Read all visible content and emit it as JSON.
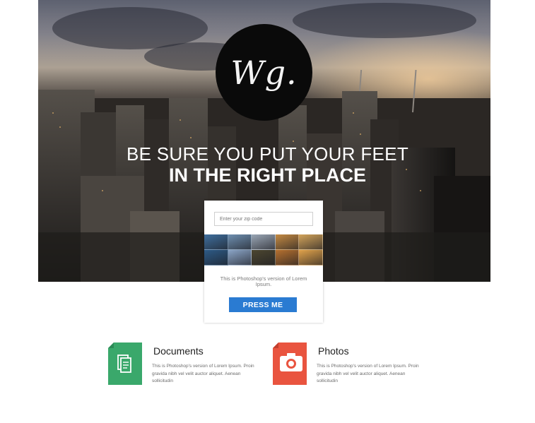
{
  "hero": {
    "logo_text": "Wg.",
    "headline_line1": "BE SURE YOU PUT YOUR FEET",
    "headline_line2": "IN THE RIGHT PLACE"
  },
  "card": {
    "zip_placeholder": "Enter your zip code",
    "description": "This is Photoshop's version of Lorem Ipsum.",
    "button_label": "PRESS ME",
    "thumbnail_colors": [
      "#3f6f9e",
      "#6e8fb0",
      "#9aa6b5",
      "#c48a43",
      "#d2a35a",
      "#2d5a86",
      "#8aa4c6",
      "#4c4630",
      "#b5702f",
      "#e0a24a"
    ]
  },
  "features": [
    {
      "title": "Documents",
      "description": "This is Photoshop's version of Lorem Ipsum. Proin gravida nibh vel velit auctor aliquet. Aenean sollicitudin",
      "icon": "documents-icon",
      "color": "#3aa86b"
    },
    {
      "title": "Photos",
      "description": "This is Photoshop's version of Lorem Ipsum. Proin gravida nibh vel velit auctor aliquet. Aenean sollicitudin",
      "icon": "camera-icon",
      "color": "#e9543f"
    }
  ],
  "colors": {
    "accent": "#2a7bd2",
    "logo_bg": "#0a0a0a"
  }
}
